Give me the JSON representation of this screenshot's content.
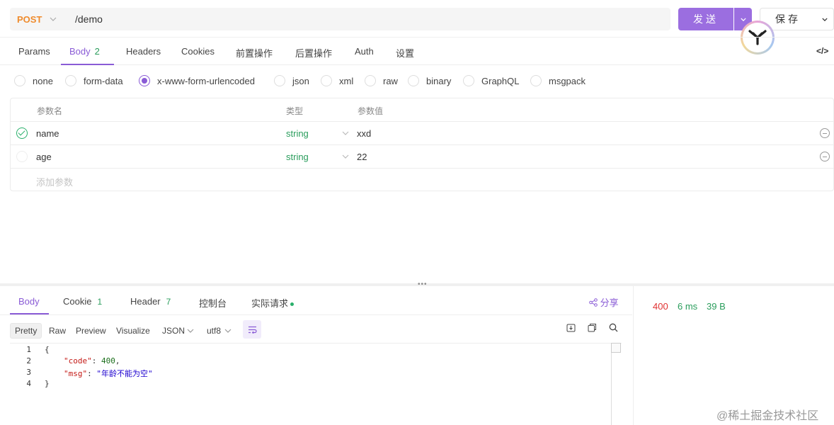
{
  "request": {
    "method": "POST",
    "url": "/demo",
    "send_label": "发送",
    "save_label": "保存"
  },
  "request_tabs": [
    {
      "label": "Params",
      "count": ""
    },
    {
      "label": "Body",
      "count": "2"
    },
    {
      "label": "Headers",
      "count": ""
    },
    {
      "label": "Cookies",
      "count": ""
    },
    {
      "label": "前置操作",
      "count": ""
    },
    {
      "label": "后置操作",
      "count": ""
    },
    {
      "label": "Auth",
      "count": ""
    },
    {
      "label": "设置",
      "count": ""
    }
  ],
  "code_toggle_label": "</>",
  "body_types": [
    "none",
    "form-data",
    "x-www-form-urlencoded",
    "json",
    "xml",
    "raw",
    "binary",
    "GraphQL",
    "msgpack"
  ],
  "body_type_selected": "x-www-form-urlencoded",
  "params_table": {
    "headers": [
      "参数名",
      "类型",
      "参数值"
    ],
    "rows": [
      {
        "name": "name",
        "type": "string",
        "value": "xxd",
        "enabled": true
      },
      {
        "name": "age",
        "type": "string",
        "value": "22",
        "enabled": false
      }
    ],
    "add_placeholder": "添加参数"
  },
  "response_tabs": [
    {
      "label": "Body",
      "count": ""
    },
    {
      "label": "Cookie",
      "count": "1"
    },
    {
      "label": "Header",
      "count": "7"
    },
    {
      "label": "控制台",
      "count": ""
    },
    {
      "label": "实际请求",
      "count": ""
    }
  ],
  "share_label": "分享",
  "view_modes": [
    "Pretty",
    "Raw",
    "Preview",
    "Visualize"
  ],
  "format_select": "JSON",
  "encoding_select": "utf8",
  "response_stats": {
    "status": "400",
    "time": "6 ms",
    "size": "39 B",
    "status_color": "#e03131",
    "ok_color": "#2a9d5c"
  },
  "response_code": {
    "line_numbers": [
      "1",
      "2",
      "3",
      "4"
    ],
    "open_brace": "{",
    "close_brace": "}",
    "key_code": "\"code\"",
    "val_code": "400",
    "key_msg": "\"msg\"",
    "val_msg": "\"年龄不能为空\""
  },
  "watermark": "@稀土掘金技术社区",
  "colors": {
    "accent": "#8a5cd6",
    "method": "#ef8b2c",
    "success": "#2a9d5c"
  }
}
